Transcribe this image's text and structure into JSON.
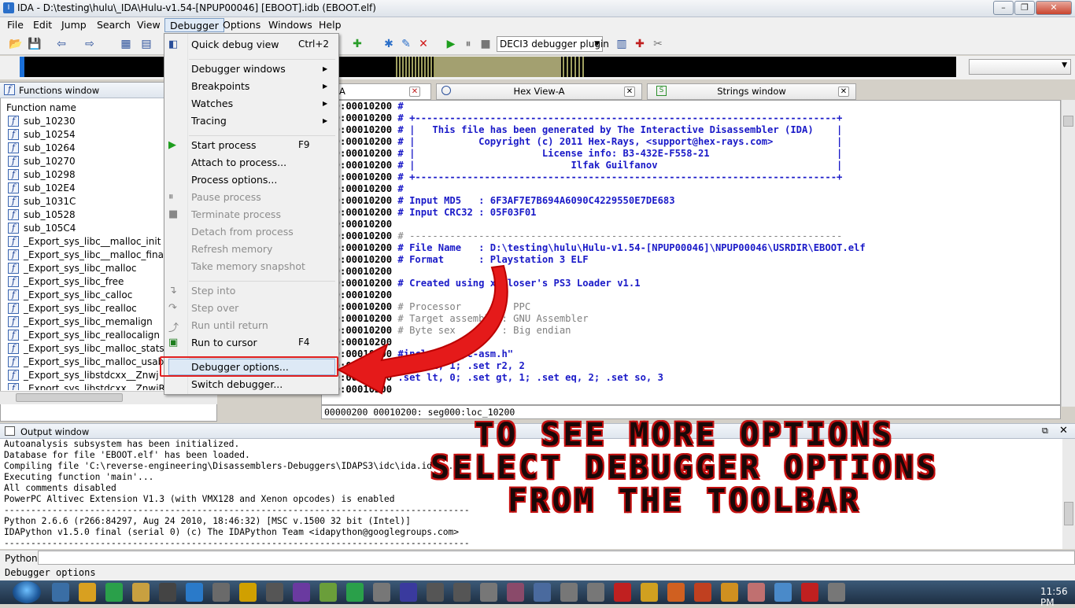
{
  "window": {
    "title": "IDA - D:\\testing\\hulu\\_IDA\\Hulu-v1.54-[NPUP00046] [EBOOT].idb (EBOOT.elf)",
    "icon": "ida-icon"
  },
  "menubar": [
    "File",
    "Edit",
    "Jump",
    "Search",
    "View",
    "Debugger",
    "Options",
    "Windows",
    "Help"
  ],
  "toolbar": {
    "debugger_select": "DECI3 debugger plugin",
    "icons": [
      "open-icon",
      "save-icon",
      "back-icon",
      "forward-icon",
      "run-icon",
      "pause-icon",
      "stop-icon"
    ]
  },
  "functions_window": {
    "title": "Functions window",
    "column": "Function name",
    "items": [
      "sub_10230",
      "sub_10254",
      "sub_10264",
      "sub_10270",
      "sub_10298",
      "sub_102E4",
      "sub_1031C",
      "sub_10528",
      "sub_105C4",
      "_Export_sys_libc__malloc_init",
      "_Export_sys_libc__malloc_finalize",
      "_Export_sys_libc_malloc",
      "_Export_sys_libc_free",
      "_Export_sys_libc_calloc",
      "_Export_sys_libc_realloc",
      "_Export_sys_libc_memalign",
      "_Export_sys_libc_reallocalign",
      "_Export_sys_libc_malloc_stats",
      "_Export_sys_libc_malloc_usable_si",
      "_Export_sys_libstdcxx__Znwj",
      "_Export_sys_libstdcxx__ZnwjRKSt9r"
    ]
  },
  "debugger_menu": {
    "groups": [
      [
        {
          "label": "Quick debug view",
          "shortcut": "Ctrl+2",
          "enabled": true
        }
      ],
      [
        {
          "label": "Debugger windows",
          "submenu": true,
          "enabled": true
        },
        {
          "label": "Breakpoints",
          "submenu": true,
          "enabled": true
        },
        {
          "label": "Watches",
          "submenu": true,
          "enabled": true
        },
        {
          "label": "Tracing",
          "submenu": true,
          "enabled": true
        }
      ],
      [
        {
          "label": "Start process",
          "shortcut": "F9",
          "enabled": true
        },
        {
          "label": "Attach to process...",
          "enabled": true
        },
        {
          "label": "Process options...",
          "enabled": true
        },
        {
          "label": "Pause process",
          "enabled": false
        },
        {
          "label": "Terminate process",
          "enabled": false
        },
        {
          "label": "Detach from process",
          "enabled": false
        },
        {
          "label": "Refresh memory",
          "enabled": false
        },
        {
          "label": "Take memory snapshot",
          "enabled": false
        }
      ],
      [
        {
          "label": "Step into",
          "enabled": false
        },
        {
          "label": "Step over",
          "enabled": false
        },
        {
          "label": "Run until return",
          "enabled": false
        },
        {
          "label": "Run to cursor",
          "shortcut": "F4",
          "enabled": true
        }
      ],
      [
        {
          "label": "Debugger options...",
          "enabled": true,
          "highlighted": true
        },
        {
          "label": "Switch debugger...",
          "enabled": true
        }
      ]
    ]
  },
  "tabs": [
    {
      "label": "A",
      "active": true
    },
    {
      "label": "Hex View-A",
      "active": false
    },
    {
      "label": "Strings window",
      "active": false
    }
  ],
  "code": [
    {
      "addr": "000:00010200",
      "text": " #",
      "style": "blue"
    },
    {
      "addr": "000:00010200",
      "text": " # +-------------------------------------------------------------------------+",
      "style": "blue"
    },
    {
      "addr": "000:00010200",
      "text": " # |   This file has been generated by The Interactive Disassembler (IDA)    |",
      "style": "blue"
    },
    {
      "addr": "000:00010200",
      "text": " # |           Copyright (c) 2011 Hex-Rays, <support@hex-rays.com>           |",
      "style": "blue"
    },
    {
      "addr": "000:00010200",
      "text": " # |                      License info: B3-432E-F558-21                      |",
      "style": "blue"
    },
    {
      "addr": "000:00010200",
      "text": " # |                           Ilfak Guilfanov                               |",
      "style": "blue"
    },
    {
      "addr": "000:00010200",
      "text": " # +-------------------------------------------------------------------------+",
      "style": "blue"
    },
    {
      "addr": "000:00010200",
      "text": " #",
      "style": "blue"
    },
    {
      "addr": "000:00010200",
      "text": " # Input MD5   : 6F3AF7E7B694A6090C4229550E7DE683",
      "style": "blue"
    },
    {
      "addr": "000:00010200",
      "text": " # Input CRC32 : 05F03F01",
      "style": "blue"
    },
    {
      "addr": "000:00010200",
      "text": "",
      "style": "blue"
    },
    {
      "addr": "000:00010200",
      "text": " # ---------------------------------------------------------------------------",
      "style": "grey"
    },
    {
      "addr": "000:00010200",
      "text": " # File Name   : D:\\testing\\hulu\\Hulu-v1.54-[NPUP00046]\\NPUP00046\\USRDIR\\EBOOT.elf",
      "style": "blue"
    },
    {
      "addr": "000:00010200",
      "text": " # Format      : Playstation 3 ELF",
      "style": "blue"
    },
    {
      "addr": "000:00010200",
      "text": "",
      "style": "blue"
    },
    {
      "addr": "000:00010200",
      "text": " # Created using xorloser's PS3 Loader v1.1",
      "style": "blue"
    },
    {
      "addr": "000:00010200",
      "text": "",
      "style": "blue"
    },
    {
      "addr": "000:00010200",
      "text": " # Processor       : PPC",
      "style": "grey"
    },
    {
      "addr": "000:00010200",
      "text": " # Target assembler: GNU Assembler",
      "style": "grey"
    },
    {
      "addr": "000:00010200",
      "text": " # Byte sex        : Big endian",
      "style": "grey"
    },
    {
      "addr": "000:00010200",
      "text": "",
      "style": "blue"
    },
    {
      "addr": "000:00010200",
      "text": " #include \"ppc-asm.h\"",
      "style": "blue"
    },
    {
      "addr": "000:00010200",
      "text": " .set r1, 1; .set r2, 2",
      "style": "blue"
    },
    {
      "addr": "000:00010200",
      "text": " .set lt, 0; .set gt, 1; .set eq, 2; .set so, 3",
      "style": "blue"
    },
    {
      "addr": "000:00010200",
      "text": "",
      "style": "blue"
    }
  ],
  "code_status": "00000200 00010200: seg000:loc_10200",
  "output_window": {
    "title": "Output window",
    "lines": [
      "Autoanalysis subsystem has been initialized.",
      "Database for file 'EBOOT.elf' has been loaded.",
      "Compiling file 'C:\\reverse-engineering\\Disassemblers-Debuggers\\IDAPS3\\idc\\ida.idc'...",
      "Executing function 'main'...",
      "All comments disabled",
      "PowerPC Altivec Extension V1.3 (with VMX128 and Xenon opcodes) is enabled",
      "---------------------------------------------------------------------------------------",
      "Python 2.6.6 (r266:84297, Aug 24 2010, 18:46:32) [MSC v.1500 32 bit (Intel)]",
      "IDAPython v1.5.0 final (serial 0) (c) The IDAPython Team <idapython@googlegroups.com>",
      "---------------------------------------------------------------------------------------"
    ]
  },
  "python_label": "Python",
  "status_text": "Debugger options",
  "overlay": {
    "line1": "TO SEE MORE OPTIONS",
    "line2": "SELECT DEBUGGER OPTIONS",
    "line3": "FROM THE TOOLBAR"
  },
  "taskbar": {
    "clock": "11:56 PM",
    "accent": "#c41010"
  }
}
